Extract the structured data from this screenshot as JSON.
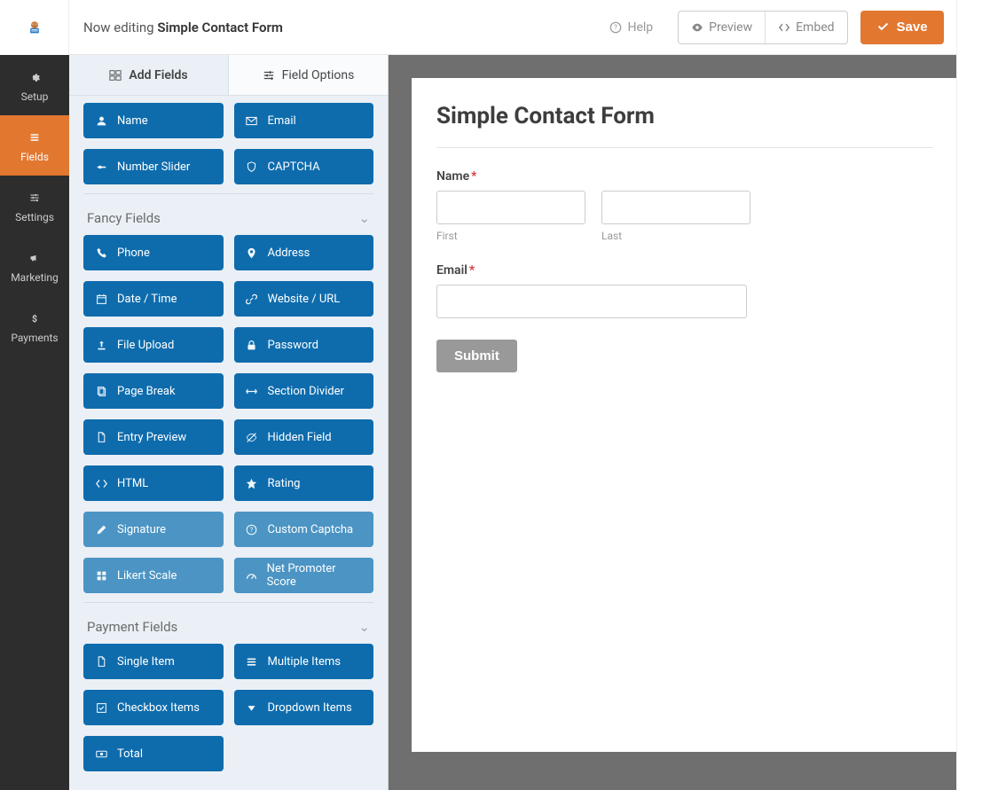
{
  "header": {
    "editing_prefix": "Now editing",
    "form_name": "Simple Contact Form",
    "help": "Help",
    "preview": "Preview",
    "embed": "Embed",
    "save": "Save"
  },
  "rail": {
    "items": [
      {
        "label": "Setup",
        "icon": "gear-icon"
      },
      {
        "label": "Fields",
        "icon": "list-icon"
      },
      {
        "label": "Settings",
        "icon": "sliders-icon"
      },
      {
        "label": "Marketing",
        "icon": "bullhorn-icon"
      },
      {
        "label": "Payments",
        "icon": "dollar-icon"
      }
    ]
  },
  "panel": {
    "tabs": {
      "add": "Add Fields",
      "options": "Field Options"
    },
    "sections": [
      {
        "title": "",
        "items": [
          {
            "label": "Name",
            "icon": "user-icon"
          },
          {
            "label": "Email",
            "icon": "envelope-icon"
          },
          {
            "label": "Number Slider",
            "icon": "sliders-h-icon"
          },
          {
            "label": "CAPTCHA",
            "icon": "shield-icon"
          }
        ]
      },
      {
        "title": "Fancy Fields",
        "items": [
          {
            "label": "Phone",
            "icon": "phone-icon"
          },
          {
            "label": "Address",
            "icon": "map-pin-icon"
          },
          {
            "label": "Date / Time",
            "icon": "calendar-icon"
          },
          {
            "label": "Website / URL",
            "icon": "link-icon"
          },
          {
            "label": "File Upload",
            "icon": "upload-icon"
          },
          {
            "label": "Password",
            "icon": "lock-icon"
          },
          {
            "label": "Page Break",
            "icon": "copy-icon"
          },
          {
            "label": "Section Divider",
            "icon": "arrows-h-icon"
          },
          {
            "label": "Entry Preview",
            "icon": "file-icon"
          },
          {
            "label": "Hidden Field",
            "icon": "eye-slash-icon"
          },
          {
            "label": "HTML",
            "icon": "code-icon"
          },
          {
            "label": "Rating",
            "icon": "star-icon"
          },
          {
            "label": "Signature",
            "icon": "pencil-icon",
            "light": true
          },
          {
            "label": "Custom Captcha",
            "icon": "question-icon",
            "light": true
          },
          {
            "label": "Likert Scale",
            "icon": "grid-icon",
            "light": true
          },
          {
            "label": "Net Promoter Score",
            "icon": "gauge-icon",
            "light": true
          }
        ]
      },
      {
        "title": "Payment Fields",
        "items": [
          {
            "label": "Single Item",
            "icon": "file-icon"
          },
          {
            "label": "Multiple Items",
            "icon": "list-icon"
          },
          {
            "label": "Checkbox Items",
            "icon": "check-square-icon"
          },
          {
            "label": "Dropdown Items",
            "icon": "caret-down-icon"
          },
          {
            "label": "Total",
            "icon": "money-icon"
          }
        ]
      }
    ]
  },
  "preview": {
    "title": "Simple Contact Form",
    "name_label": "Name",
    "first": "First",
    "last": "Last",
    "email_label": "Email",
    "submit": "Submit"
  }
}
